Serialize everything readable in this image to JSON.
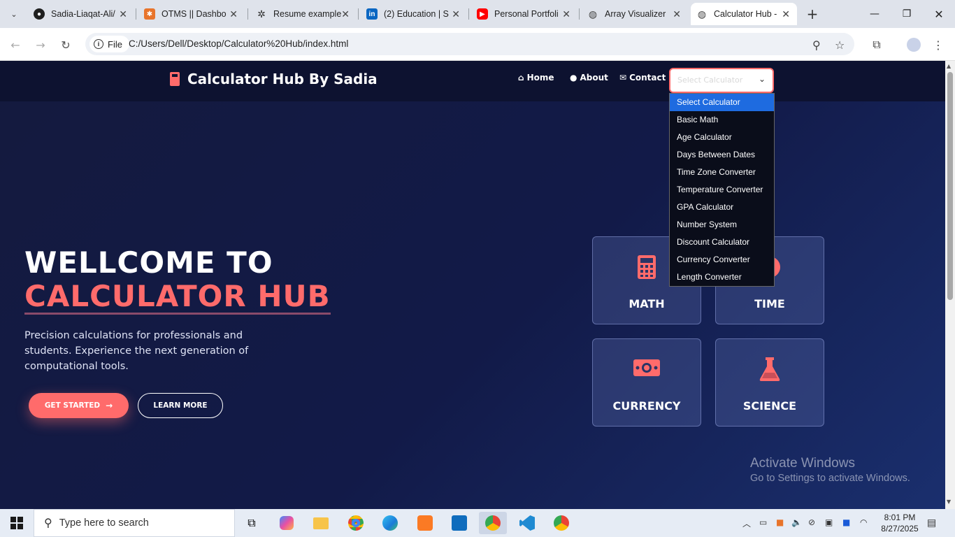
{
  "browser": {
    "tabs": [
      {
        "label": "Sadia-Liaqat-Ali/",
        "icon": "github-icon"
      },
      {
        "label": "OTMS || Dashbo",
        "icon": "xampp-icon"
      },
      {
        "label": "Resume example",
        "icon": "chatgpt-icon"
      },
      {
        "label": "(2) Education | S",
        "icon": "linkedin-icon"
      },
      {
        "label": "Personal Portfoli",
        "icon": "youtube-icon"
      },
      {
        "label": "Array Visualizer",
        "icon": "globe-icon"
      },
      {
        "label": "Calculator Hub -",
        "icon": "globe-icon",
        "active": true
      }
    ],
    "address": {
      "scheme_chip": "File",
      "url": "C:/Users/Dell/Desktop/Calculator%20Hub/index.html"
    }
  },
  "page": {
    "brand": "Calculator Hub By Sadia",
    "nav": [
      {
        "label": "Home",
        "icon": "home-icon"
      },
      {
        "label": "About",
        "icon": "user-icon"
      },
      {
        "label": "Contact",
        "icon": "envelope-icon"
      }
    ],
    "calculator_select": {
      "placeholder": "Select Calculator",
      "options": [
        "Select Calculator",
        "Basic Math",
        "Age Calculator",
        "Days Between Dates",
        "Time Zone Converter",
        "Temperature Converter",
        "GPA Calculator",
        "Number System",
        "Discount Calculator",
        "Currency Converter",
        "Length Converter"
      ],
      "selected": "Select Calculator"
    },
    "hero": {
      "title_line1": "WELLCOME TO",
      "title_line2": "CALCULATOR HUB",
      "subtitle": "Precision calculations for professionals and students. Experience the next generation of computational tools.",
      "primary_button": "GET STARTED",
      "secondary_button": "LEARN MORE"
    },
    "cards": [
      {
        "label": "MATH",
        "icon": "calculator-icon"
      },
      {
        "label": "TIME",
        "icon": "clock-icon"
      },
      {
        "label": "CURRENCY",
        "icon": "money-icon"
      },
      {
        "label": "SCIENCE",
        "icon": "flask-icon"
      }
    ],
    "watermark": {
      "line1": "Activate Windows",
      "line2": "Go to Settings to activate Windows."
    }
  },
  "taskbar": {
    "search_placeholder": "Type here to search",
    "time": "8:01 PM",
    "date": "8/27/2025"
  },
  "colors": {
    "accent": "#ff6b6b",
    "page_bg": "#121a48",
    "navbar_bg": "#0d1230",
    "dropdown_highlight": "#1e6be0"
  }
}
